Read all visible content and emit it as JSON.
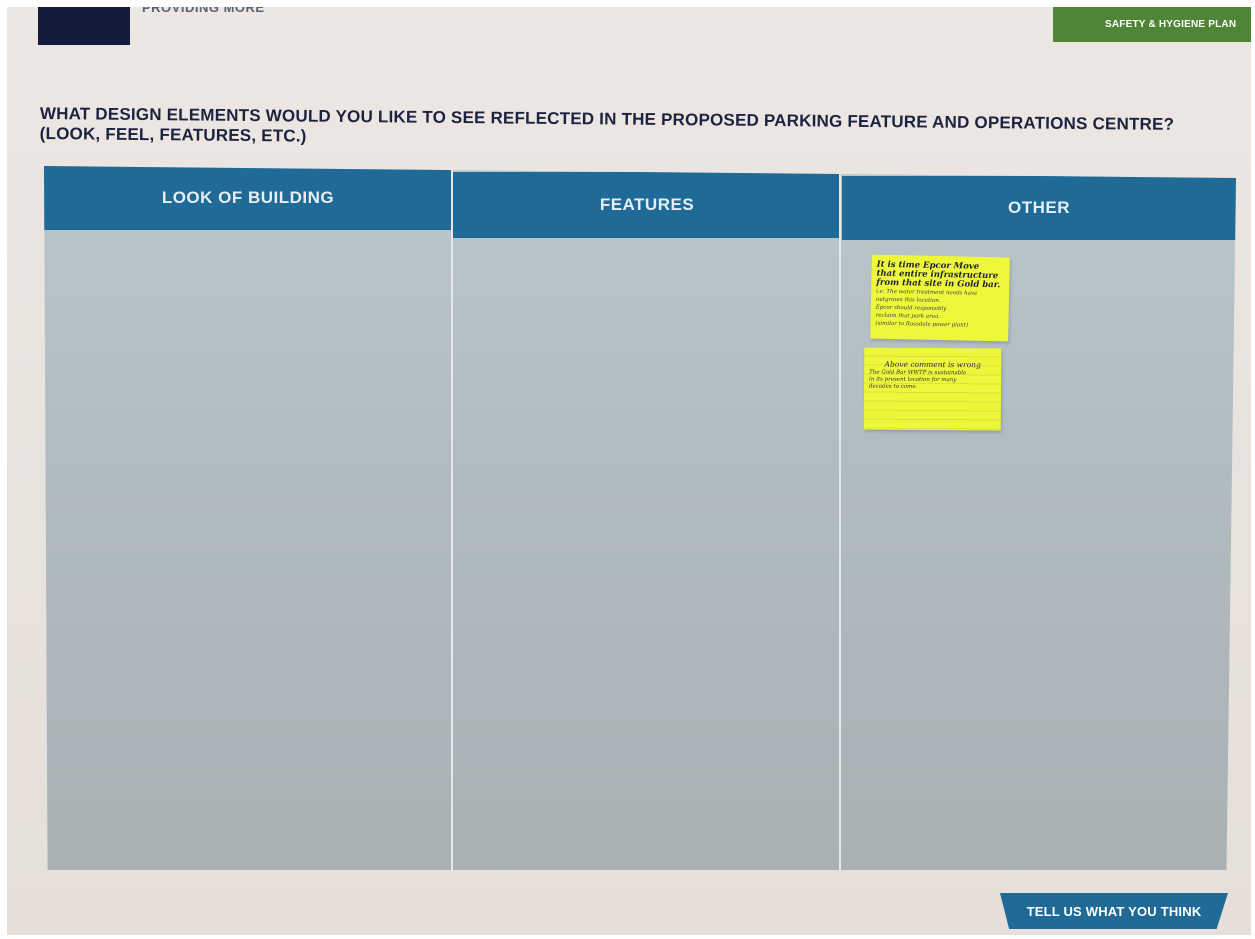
{
  "header": {
    "tagline": "PROVIDING MORE",
    "banner_text": "SAFETY & HYGIENE PLAN"
  },
  "question": {
    "line1": "WHAT DESIGN ELEMENTS WOULD YOU LIKE TO SEE REFLECTED IN THE PROPOSED PARKING FEATURE AND OPERATIONS CENTRE?",
    "line2": "(LOOK, FEEL, FEATURES, ETC.)"
  },
  "columns": [
    {
      "header": "LOOK OF BUILDING"
    },
    {
      "header": "FEATURES"
    },
    {
      "header": "OTHER"
    }
  ],
  "sticky_notes": [
    {
      "lines_bold": [
        "It is time Epcor Move",
        "that entire infrastructure",
        "from that site in Gold bar."
      ],
      "lines_small": [
        "i.e. The water treatment needs have",
        "outgrown this location.",
        "Epcor should responsibly",
        "reclaim that park area.",
        "(similar to Rossdale power plant)"
      ]
    },
    {
      "lines_first": "Above comment is wrong",
      "lines_rest": [
        "The Gold Bar WWTP is sustainable",
        "in its present location for many",
        "decades to come."
      ]
    }
  ],
  "footer": {
    "cta_label": "TELL US WHAT YOU THINK"
  },
  "colors": {
    "header_blue": "#1f6a96",
    "board_gray": "#b0bbc0",
    "banner_green": "#4f8536",
    "logo_navy": "#141c3d",
    "sticky_yellow": "#eef83a"
  }
}
